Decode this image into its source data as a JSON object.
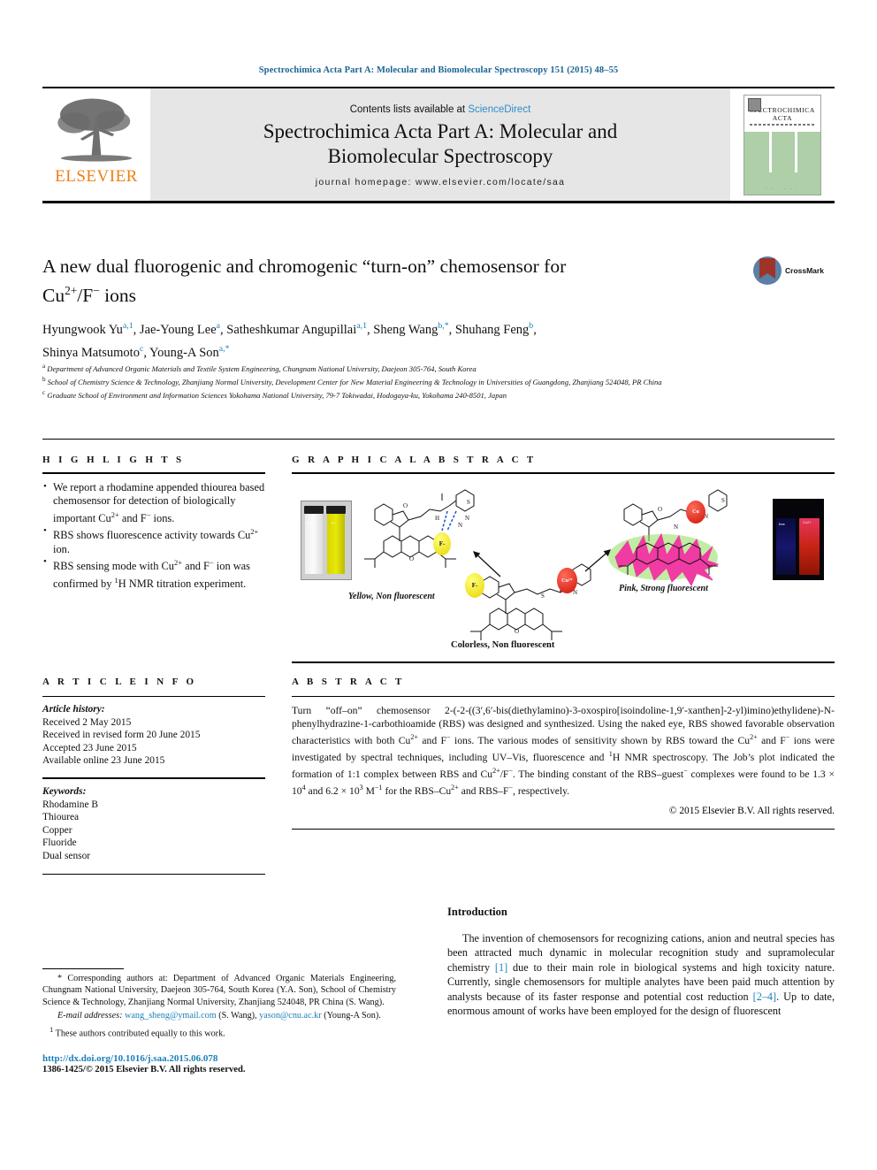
{
  "running_head": "Spectrochimica Acta Part A: Molecular and Biomolecular Spectroscopy 151 (2015) 48–55",
  "masthead": {
    "contents_prefix": "Contents lists available at ",
    "sciencedirect": "ScienceDirect",
    "journal_title_line1": "Spectrochimica Acta Part A: Molecular and",
    "journal_title_line2": "Biomolecular Spectroscopy",
    "homepage": "journal homepage: www.elsevier.com/locate/saa",
    "publisher": "ELSEVIER",
    "cover_name_line1": "SPECTROCHIMICA",
    "cover_name_line2": "ACTA",
    "accent_orange": "#f07f12",
    "link_blue": "#2b8ccc",
    "cover_green": "#aecfa8"
  },
  "article": {
    "title_line1": "A new dual fluorogenic and chromogenic “turn-on” chemosensor for",
    "title_line2_pre": "Cu",
    "title_line2_sup1": "2+",
    "title_line2_mid": "/F",
    "title_line2_sup2": "−",
    "title_line2_post": " ions",
    "crossmark_label": "CrossMark",
    "authors": "Hyungwook Yu a,1, Jae-Young Lee a, Satheshkumar Angupillai a,1, Sheng Wang b,*, Shuhang Feng b, Shinya Matsumoto c, Young-A Son a,*",
    "affiliations": [
      "a Department of Advanced Organic Materials and Textile System Engineering, Chungnam National University, Daejeon 305-764, South Korea",
      "b School of Chemistry Science & Technology, Zhanjiang Normal University, Development Center for New Material Engineering & Technology in Universities of Guangdong, Zhanjiang 524048, PR China",
      "c Graduate School of Environment and Information Sciences Yokohama National University, 79-7 Tokiwadai, Hodogaya-ku, Yokohama 240-8501, Japan"
    ]
  },
  "highlights": {
    "heading": "H I G H L I G H T S",
    "items": [
      "We report a rhodamine appended thiourea based chemosensor for detection of biologically important Cu2+ and F− ions.",
      "RBS shows fluorescence activity towards Cu2+ ion.",
      "RBS sensing mode with Cu2+ and F− ion was confirmed by 1H NMR titration experiment."
    ]
  },
  "graphical_abstract": {
    "heading": "G R A P H I C A L   A B S T R A C T",
    "captions": {
      "left": "Yellow, Non fluorescent",
      "center": "Colorless, Non fluorescent",
      "right": "Pink, Strong fluorescent"
    },
    "ion_labels": {
      "fluoride": "F−",
      "copper": "Cu2+"
    },
    "vial_labels": {
      "left_photo_left": "free",
      "left_photo_right": "F−",
      "right_photo_left": "free",
      "right_photo_right": "Cu2+"
    }
  },
  "article_info": {
    "heading": "A R T I C L E   I N F O",
    "history_label": "Article history:",
    "history": [
      "Received 2 May 2015",
      "Received in revised form 20 June 2015",
      "Accepted 23 June 2015",
      "Available online 23 June 2015"
    ],
    "keywords_label": "Keywords:",
    "keywords": [
      "Rhodamine B",
      "Thiourea",
      "Copper",
      "Fluoride",
      "Dual sensor"
    ]
  },
  "abstract": {
    "heading": "A B S T R A C T",
    "body": "Turn “off–on” chemosensor 2-(-2-((3′,6′-bis(diethylamino)-3-oxospiro[isoindoline-1,9′-xanthen]-2-yl)imino)ethylidene)-N-phenylhydrazine-1-carbothioamide (RBS) was designed and synthesized. Using the naked eye, RBS showed favorable observation characteristics with both Cu2+ and F− ions. The various modes of sensitivity shown by RBS toward the Cu2+ and F− ions were investigated by spectral techniques, including UV–Vis, fluorescence and 1H NMR spectroscopy. The Job’s plot indicated the formation of 1:1 complex between RBS and Cu2+/F−. The binding constant of the RBS–guest− complexes were found to be 1.3 × 104 and 6.2 × 103 M−1 for the RBS–Cu2+ and RBS–F−, respectively.",
    "copyright": "© 2015 Elsevier B.V. All rights reserved."
  },
  "footnotes": {
    "corresponding": "* Corresponding authors at: Department of Advanced Organic Materials Engineering, Chungnam National University, Daejeon 305-764, South Korea (Y.A. Son), School of Chemistry Science & Technology, Zhanjiang Normal University, Zhanjiang 524048, PR China (S. Wang).",
    "email_label": "E-mail addresses:",
    "email1": "wang_sheng@ymail.com",
    "email1_owner": "(S. Wang),",
    "email2": "yason@cnu.ac.kr",
    "email2_owner": "(Young-A Son).",
    "equal_contrib": "1 These authors contributed equally to this work.",
    "doi": "http://dx.doi.org/10.1016/j.saa.2015.06.078",
    "issn": "1386-1425/© 2015 Elsevier B.V. All rights reserved."
  },
  "introduction": {
    "heading": "Introduction",
    "paragraph_part1": "The invention of chemosensors for recognizing cations, anion and neutral species has been attracted much dynamic in molecular recognition study and supramolecular chemistry ",
    "ref1": "[1]",
    "paragraph_part2": " due to their main role in biological systems and high toxicity nature. Currently, single chemosensors for multiple analytes have been paid much attention by analysts because of its faster response and potential cost reduction ",
    "ref2": "[2–4]",
    "paragraph_part3": ". Up to date, enormous amount of works have been employed for the design of fluorescent"
  }
}
